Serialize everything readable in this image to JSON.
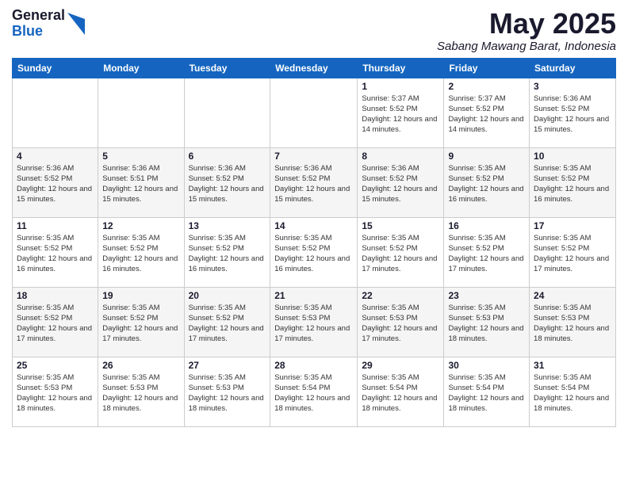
{
  "header": {
    "logo_general": "General",
    "logo_blue": "Blue",
    "month_title": "May 2025",
    "location": "Sabang Mawang Barat, Indonesia"
  },
  "weekdays": [
    "Sunday",
    "Monday",
    "Tuesday",
    "Wednesday",
    "Thursday",
    "Friday",
    "Saturday"
  ],
  "weeks": [
    [
      {
        "day": "",
        "sunrise": "",
        "sunset": "",
        "daylight": ""
      },
      {
        "day": "",
        "sunrise": "",
        "sunset": "",
        "daylight": ""
      },
      {
        "day": "",
        "sunrise": "",
        "sunset": "",
        "daylight": ""
      },
      {
        "day": "",
        "sunrise": "",
        "sunset": "",
        "daylight": ""
      },
      {
        "day": "1",
        "sunrise": "Sunrise: 5:37 AM",
        "sunset": "Sunset: 5:52 PM",
        "daylight": "Daylight: 12 hours and 14 minutes."
      },
      {
        "day": "2",
        "sunrise": "Sunrise: 5:37 AM",
        "sunset": "Sunset: 5:52 PM",
        "daylight": "Daylight: 12 hours and 14 minutes."
      },
      {
        "day": "3",
        "sunrise": "Sunrise: 5:36 AM",
        "sunset": "Sunset: 5:52 PM",
        "daylight": "Daylight: 12 hours and 15 minutes."
      }
    ],
    [
      {
        "day": "4",
        "sunrise": "Sunrise: 5:36 AM",
        "sunset": "Sunset: 5:52 PM",
        "daylight": "Daylight: 12 hours and 15 minutes."
      },
      {
        "day": "5",
        "sunrise": "Sunrise: 5:36 AM",
        "sunset": "Sunset: 5:51 PM",
        "daylight": "Daylight: 12 hours and 15 minutes."
      },
      {
        "day": "6",
        "sunrise": "Sunrise: 5:36 AM",
        "sunset": "Sunset: 5:52 PM",
        "daylight": "Daylight: 12 hours and 15 minutes."
      },
      {
        "day": "7",
        "sunrise": "Sunrise: 5:36 AM",
        "sunset": "Sunset: 5:52 PM",
        "daylight": "Daylight: 12 hours and 15 minutes."
      },
      {
        "day": "8",
        "sunrise": "Sunrise: 5:36 AM",
        "sunset": "Sunset: 5:52 PM",
        "daylight": "Daylight: 12 hours and 15 minutes."
      },
      {
        "day": "9",
        "sunrise": "Sunrise: 5:35 AM",
        "sunset": "Sunset: 5:52 PM",
        "daylight": "Daylight: 12 hours and 16 minutes."
      },
      {
        "day": "10",
        "sunrise": "Sunrise: 5:35 AM",
        "sunset": "Sunset: 5:52 PM",
        "daylight": "Daylight: 12 hours and 16 minutes."
      }
    ],
    [
      {
        "day": "11",
        "sunrise": "Sunrise: 5:35 AM",
        "sunset": "Sunset: 5:52 PM",
        "daylight": "Daylight: 12 hours and 16 minutes."
      },
      {
        "day": "12",
        "sunrise": "Sunrise: 5:35 AM",
        "sunset": "Sunset: 5:52 PM",
        "daylight": "Daylight: 12 hours and 16 minutes."
      },
      {
        "day": "13",
        "sunrise": "Sunrise: 5:35 AM",
        "sunset": "Sunset: 5:52 PM",
        "daylight": "Daylight: 12 hours and 16 minutes."
      },
      {
        "day": "14",
        "sunrise": "Sunrise: 5:35 AM",
        "sunset": "Sunset: 5:52 PM",
        "daylight": "Daylight: 12 hours and 16 minutes."
      },
      {
        "day": "15",
        "sunrise": "Sunrise: 5:35 AM",
        "sunset": "Sunset: 5:52 PM",
        "daylight": "Daylight: 12 hours and 17 minutes."
      },
      {
        "day": "16",
        "sunrise": "Sunrise: 5:35 AM",
        "sunset": "Sunset: 5:52 PM",
        "daylight": "Daylight: 12 hours and 17 minutes."
      },
      {
        "day": "17",
        "sunrise": "Sunrise: 5:35 AM",
        "sunset": "Sunset: 5:52 PM",
        "daylight": "Daylight: 12 hours and 17 minutes."
      }
    ],
    [
      {
        "day": "18",
        "sunrise": "Sunrise: 5:35 AM",
        "sunset": "Sunset: 5:52 PM",
        "daylight": "Daylight: 12 hours and 17 minutes."
      },
      {
        "day": "19",
        "sunrise": "Sunrise: 5:35 AM",
        "sunset": "Sunset: 5:52 PM",
        "daylight": "Daylight: 12 hours and 17 minutes."
      },
      {
        "day": "20",
        "sunrise": "Sunrise: 5:35 AM",
        "sunset": "Sunset: 5:52 PM",
        "daylight": "Daylight: 12 hours and 17 minutes."
      },
      {
        "day": "21",
        "sunrise": "Sunrise: 5:35 AM",
        "sunset": "Sunset: 5:53 PM",
        "daylight": "Daylight: 12 hours and 17 minutes."
      },
      {
        "day": "22",
        "sunrise": "Sunrise: 5:35 AM",
        "sunset": "Sunset: 5:53 PM",
        "daylight": "Daylight: 12 hours and 17 minutes."
      },
      {
        "day": "23",
        "sunrise": "Sunrise: 5:35 AM",
        "sunset": "Sunset: 5:53 PM",
        "daylight": "Daylight: 12 hours and 18 minutes."
      },
      {
        "day": "24",
        "sunrise": "Sunrise: 5:35 AM",
        "sunset": "Sunset: 5:53 PM",
        "daylight": "Daylight: 12 hours and 18 minutes."
      }
    ],
    [
      {
        "day": "25",
        "sunrise": "Sunrise: 5:35 AM",
        "sunset": "Sunset: 5:53 PM",
        "daylight": "Daylight: 12 hours and 18 minutes."
      },
      {
        "day": "26",
        "sunrise": "Sunrise: 5:35 AM",
        "sunset": "Sunset: 5:53 PM",
        "daylight": "Daylight: 12 hours and 18 minutes."
      },
      {
        "day": "27",
        "sunrise": "Sunrise: 5:35 AM",
        "sunset": "Sunset: 5:53 PM",
        "daylight": "Daylight: 12 hours and 18 minutes."
      },
      {
        "day": "28",
        "sunrise": "Sunrise: 5:35 AM",
        "sunset": "Sunset: 5:54 PM",
        "daylight": "Daylight: 12 hours and 18 minutes."
      },
      {
        "day": "29",
        "sunrise": "Sunrise: 5:35 AM",
        "sunset": "Sunset: 5:54 PM",
        "daylight": "Daylight: 12 hours and 18 minutes."
      },
      {
        "day": "30",
        "sunrise": "Sunrise: 5:35 AM",
        "sunset": "Sunset: 5:54 PM",
        "daylight": "Daylight: 12 hours and 18 minutes."
      },
      {
        "day": "31",
        "sunrise": "Sunrise: 5:35 AM",
        "sunset": "Sunset: 5:54 PM",
        "daylight": "Daylight: 12 hours and 18 minutes."
      }
    ]
  ]
}
